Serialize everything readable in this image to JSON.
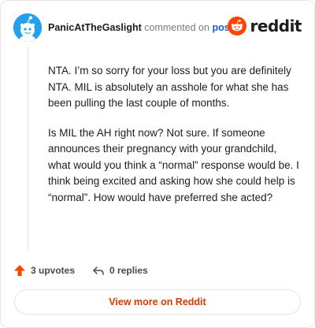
{
  "comment": {
    "author": "PanicAtTheGaslight",
    "commented_text": "commented on",
    "post_link": "post",
    "paragraphs": [
      "NTA. I’m so sorry for your loss but you are definitely NTA. MIL is absolutely an asshole for what she has been pulling the last couple of months.",
      "Is MIL the AH right now? Not sure. If someone announces their pregnancy with your grandchild, what would you think a “normal” response would be. I think being excited and asking how she could help is “normal”. How would have preferred she acted?"
    ]
  },
  "brand": {
    "wordmark": "reddit",
    "color": "#ff4500"
  },
  "actions": {
    "upvotes": "3 upvotes",
    "replies": "0 replies"
  },
  "footer": {
    "view_more": "View more on Reddit"
  },
  "colors": {
    "avatar": "#24a0ed",
    "upvote_arrow": "#ff4500",
    "link": "#1a5cc4",
    "view_more": "#d93a00"
  }
}
